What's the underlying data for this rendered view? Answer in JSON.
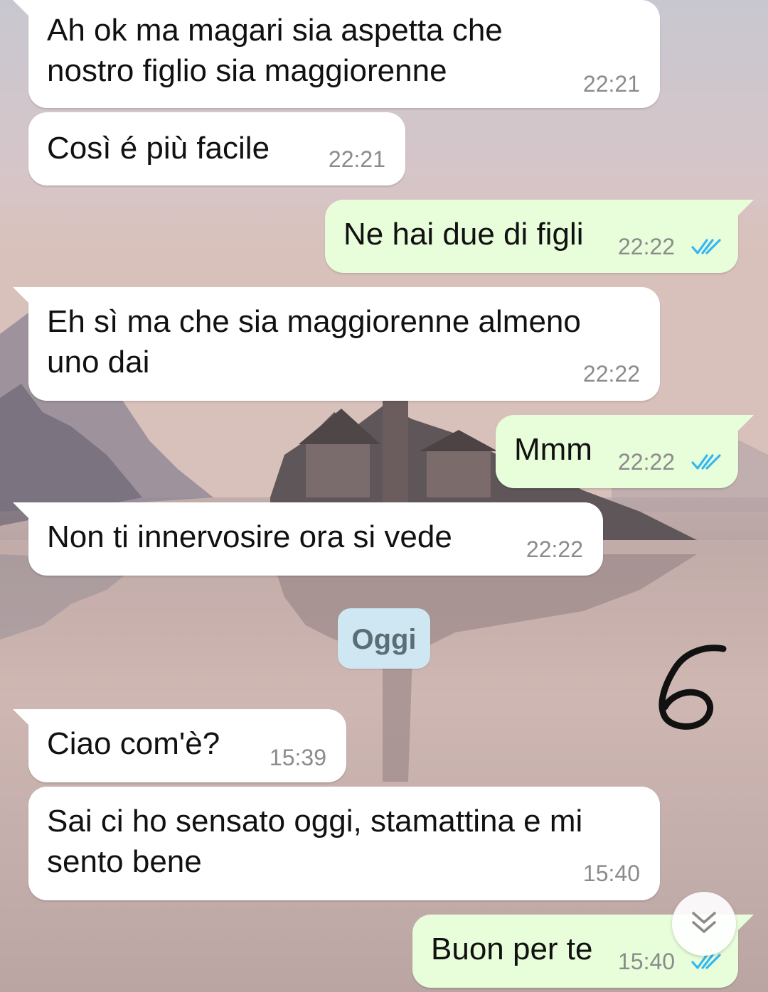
{
  "colors": {
    "incoming_bubble": "#ffffff",
    "outgoing_bubble": "#e8fdd9",
    "read_ticks": "#34b7f1",
    "date_chip": "#cfe7f2"
  },
  "messages": [
    {
      "direction": "incoming",
      "lines": [
        "Ah ok ma magari sia aspetta che",
        "nostro figlio sia maggiorenne"
      ],
      "time": "22:21"
    },
    {
      "direction": "incoming",
      "lines": [
        "Così é più facile"
      ],
      "time": "22:21"
    },
    {
      "direction": "outgoing",
      "lines": [
        "Ne hai due di figli"
      ],
      "time": "22:22",
      "status": "read"
    },
    {
      "direction": "incoming",
      "lines": [
        "Eh sì ma che sia maggiorenne almeno",
        "uno dai"
      ],
      "time": "22:22"
    },
    {
      "direction": "outgoing",
      "lines": [
        "Mmm"
      ],
      "time": "22:22",
      "status": "read"
    },
    {
      "direction": "incoming",
      "lines": [
        "Non ti innervosire ora si vede"
      ],
      "time": "22:22"
    },
    {
      "direction": "incoming",
      "lines": [
        "Ciao com'è?"
      ],
      "time": "15:39"
    },
    {
      "direction": "incoming",
      "lines": [
        "Sai ci ho sensato oggi, stamattina e mi",
        "sento bene"
      ],
      "time": "15:40"
    },
    {
      "direction": "outgoing",
      "lines": [
        "Buon per te"
      ],
      "time": "15:40",
      "status": "read"
    }
  ],
  "date_separator": "Oggi",
  "handwritten_annotation": "6",
  "icons": {
    "read_receipt": "double-check-icon",
    "scroll_down": "double-chevron-down-icon"
  }
}
